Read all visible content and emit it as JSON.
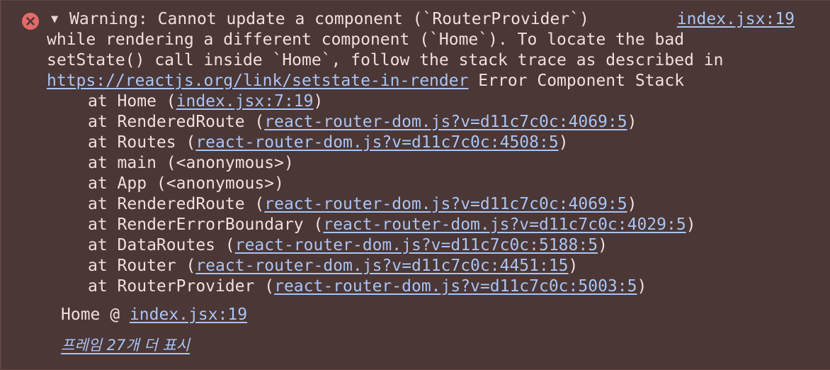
{
  "console_entry": {
    "level_icon": "error-circle-x-icon",
    "toggle_icon": "triangle-down-icon",
    "source_link": "index.jsx:19",
    "message_line1": "Warning: Cannot update a component (`RouterProvider`)",
    "message_line2": "while rendering a different component (`Home`). To locate the bad",
    "message_line3": "setState() call inside `Home`, follow the stack trace as described in",
    "doc_link": "https://reactjs.org/link/setstate-in-render",
    "after_link_text": " Error Component Stack",
    "stack": [
      {
        "prefix": "at Home (",
        "link": "index.jsx:7:19",
        "suffix": ")"
      },
      {
        "prefix": "at RenderedRoute (",
        "link": "react-router-dom.js?v=d11c7c0c:4069:5",
        "suffix": ")"
      },
      {
        "prefix": "at Routes (",
        "link": "react-router-dom.js?v=d11c7c0c:4508:5",
        "suffix": ")"
      },
      {
        "prefix": "at main (<anonymous>)",
        "link": "",
        "suffix": ""
      },
      {
        "prefix": "at App (<anonymous>)",
        "link": "",
        "suffix": ""
      },
      {
        "prefix": "at RenderedRoute (",
        "link": "react-router-dom.js?v=d11c7c0c:4069:5",
        "suffix": ")"
      },
      {
        "prefix": "at RenderErrorBoundary (",
        "link": "react-router-dom.js?v=d11c7c0c:4029:5",
        "suffix": ")"
      },
      {
        "prefix": "at DataRoutes (",
        "link": "react-router-dom.js?v=d11c7c0c:5188:5",
        "suffix": ")"
      },
      {
        "prefix": "at Router (",
        "link": "react-router-dom.js?v=d11c7c0c:4451:15",
        "suffix": ")"
      },
      {
        "prefix": "at RouterProvider (",
        "link": "react-router-dom.js?v=d11c7c0c:5003:5",
        "suffix": ")"
      }
    ],
    "summary_prefix": "Home @ ",
    "summary_link": "index.jsx:19",
    "show_more": "프레임 27개 더 표시"
  },
  "colors": {
    "background": "#4b3735",
    "text": "#f1dede",
    "link": "#a9c4f5",
    "error_icon": "#e46a6a"
  }
}
